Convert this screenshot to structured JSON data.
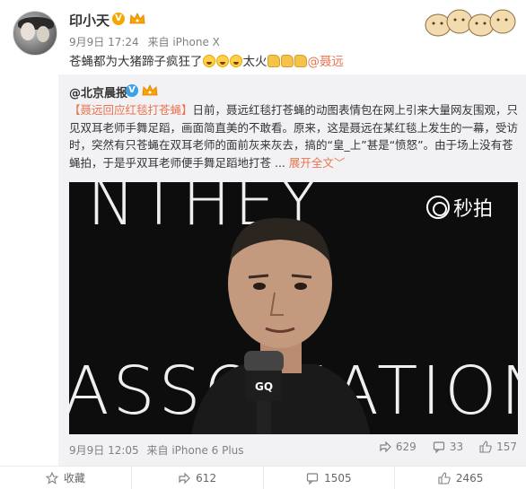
{
  "post": {
    "author": "印小天",
    "date": "9月9日 17:24",
    "source_prefix": "来自",
    "source": "iPhone X",
    "text_main": "苍蝇都为大猪蹄子疯狂了",
    "text_mid": "太火",
    "mention": "@聂远"
  },
  "repost": {
    "author": "@北京晨报",
    "tag": "【聂远回应红毯打苍蝇】",
    "body": "日前，聂远红毯打苍蝇的动图表情包在网上引来大量网友围观，只见双耳老师手舞足蹈，画面简直美的不敢看。原来，这是聂远在某红毯上发生的一幕，受访时，突然有只苍蝇在双耳老师的面前灰来灰去，搞的“皇_上”甚是“愤怒”。由于场上没有苍蝇拍，于是乎双耳老师便手舞足蹈地打苍 ...",
    "expand_label": "展开全文",
    "expand_arrow": "﹀",
    "video": {
      "watermark": "秒拍",
      "bg_top": "NTHEY",
      "bg_bottom": "ASSOCIATION"
    },
    "date": "9月9日 12:05",
    "source_prefix": "来自",
    "source": "iPhone 6 Plus",
    "share_count": "629",
    "comment_count": "33",
    "like_count": "157"
  },
  "footer": {
    "favorite_label": "收藏",
    "share_count": "612",
    "comment_count": "1505",
    "like_count": "2465"
  },
  "colors": {
    "accent": "#eb7350",
    "verified_gold": "#f7a500",
    "verified_blue": "#3aa1e6",
    "repost_bg": "#f2f2f5"
  }
}
